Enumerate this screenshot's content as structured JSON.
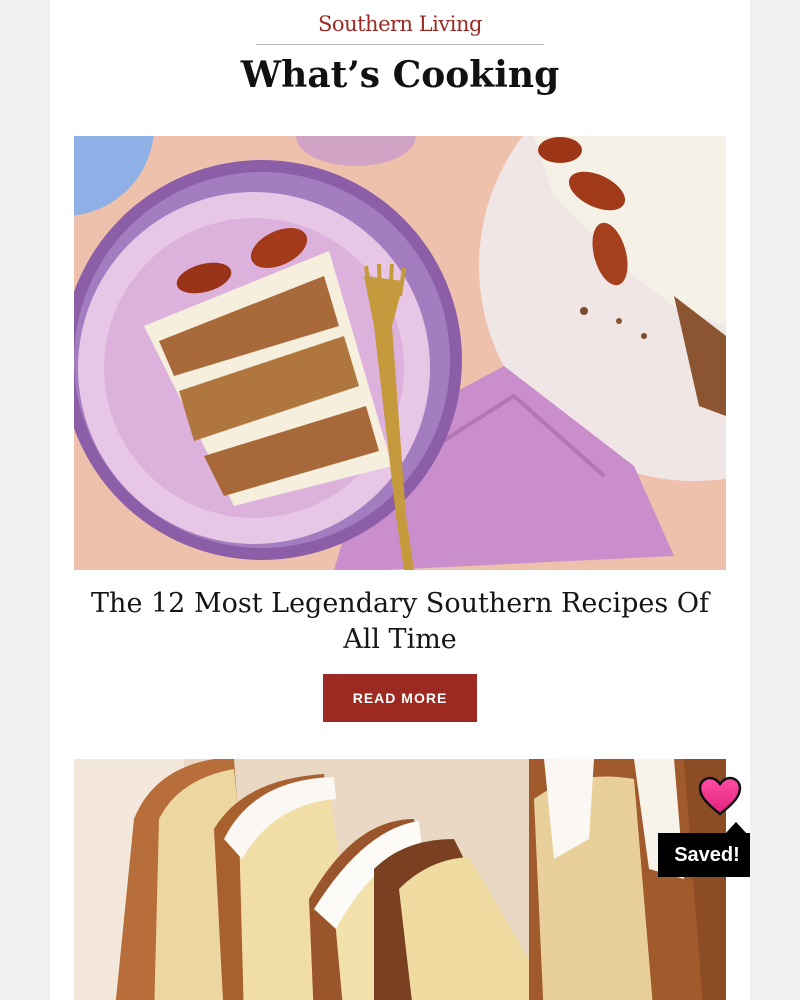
{
  "header": {
    "brand": "Southern Living",
    "section_title": "What’s Cooking"
  },
  "articles": [
    {
      "title": "The 12 Most Legendary Southern Recipes Of All Time",
      "cta_label": "READ MORE",
      "image": "hummingbird-cake-slice-photo"
    },
    {
      "image": "glazed-pound-cake-photo"
    }
  ],
  "overlay": {
    "saved_label": "Saved!",
    "icon": "heart-icon"
  },
  "colors": {
    "brand": "#9c2a22",
    "page_bg": "#f0f0f0",
    "card_bg": "#ffffff",
    "badge_bg": "#000000"
  }
}
